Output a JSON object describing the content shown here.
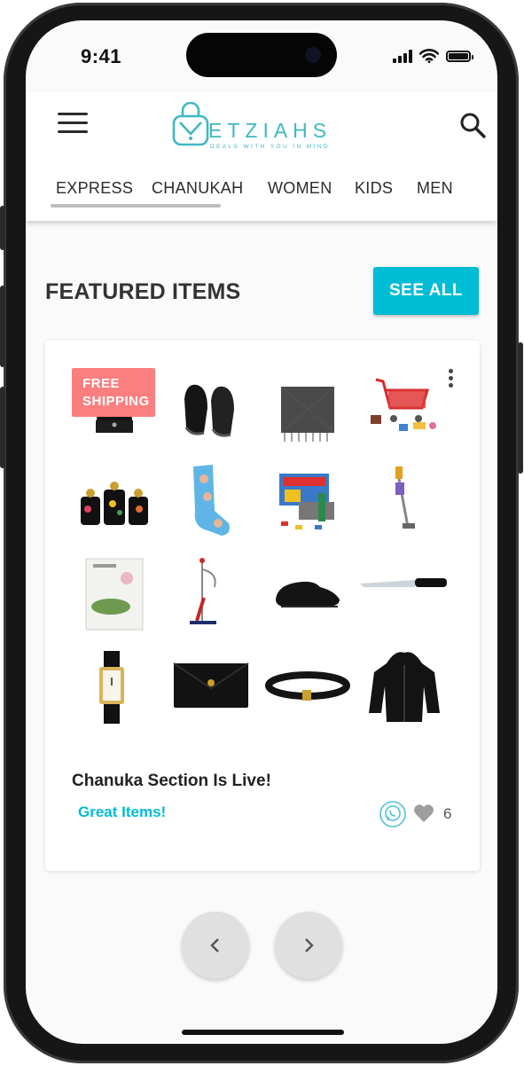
{
  "status_bar": {
    "time": "9:41"
  },
  "header": {
    "logo_wordmark": "ETZIAHS",
    "logo_tagline": "DEALS WITH YOU IN MIND",
    "tabs": [
      {
        "label": "EXPRESS"
      },
      {
        "label": "CHANUKAH"
      },
      {
        "label": "WOMEN"
      },
      {
        "label": "KIDS"
      },
      {
        "label": "MEN"
      }
    ]
  },
  "featured": {
    "title": "FEATURED ITEMS",
    "see_all_label": "SEE ALL"
  },
  "card": {
    "badge": "FREE SHIPPING",
    "title": "Chanuka Section Is Live!",
    "subtitle": "Great Items!",
    "like_count": "6",
    "products": [
      "beanie",
      "slippers",
      "scarf",
      "toy-shopping-cart",
      "canister-set",
      "photo-socks",
      "toy-garage-playset",
      "toy-vacuum",
      "cookbook",
      "batting-tee",
      "slide-slippers",
      "bread-knife",
      "wrist-watch",
      "clutch-bag",
      "leather-belt",
      "zip-hoodie"
    ]
  },
  "pagination": {
    "prev_icon": "chevron-left-icon",
    "next_icon": "chevron-right-icon"
  },
  "colors": {
    "accent": "#00bcd4",
    "badge": "#fb7f7f",
    "logo": "#3fb8c3"
  }
}
